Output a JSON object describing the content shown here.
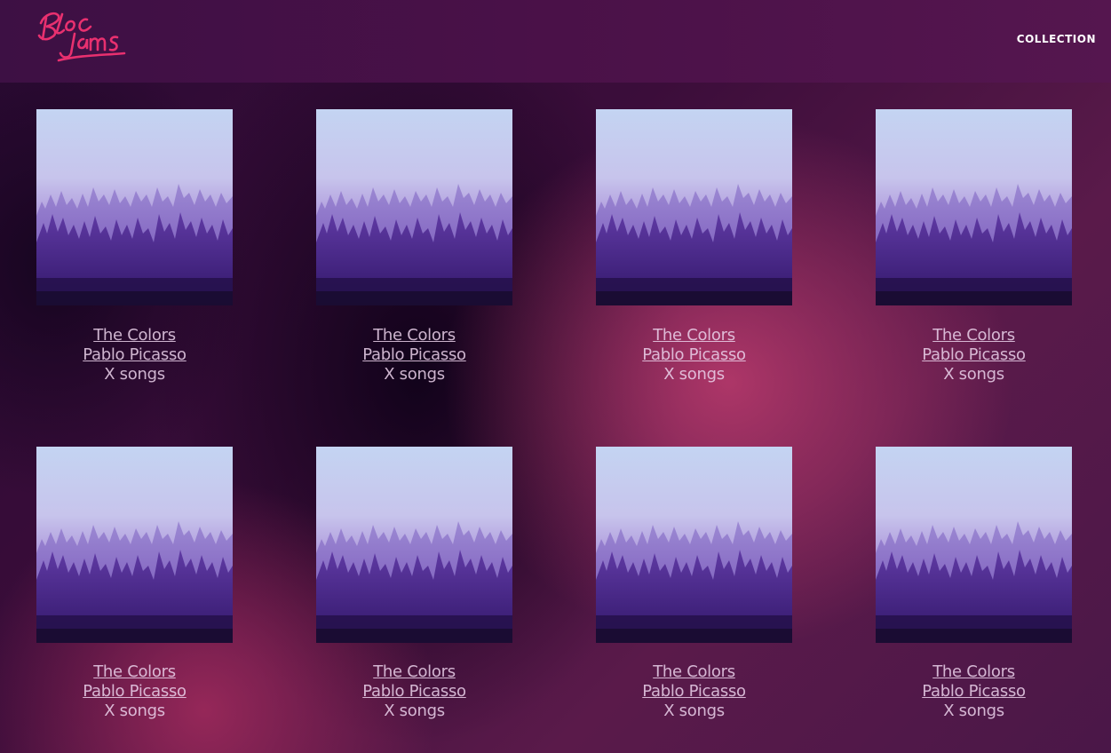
{
  "app": {
    "logo_text": "Bloc Jams",
    "brand_color": "#e8306f"
  },
  "navbar": {
    "collection_label": "COLLECTION"
  },
  "albums": [
    {
      "title": "The Colors ",
      "artist": "Pablo Picasso ",
      "count": "X songs"
    },
    {
      "title": "The Colors ",
      "artist": "Pablo Picasso ",
      "count": "X songs"
    },
    {
      "title": "The Colors ",
      "artist": "Pablo Picasso ",
      "count": "X songs"
    },
    {
      "title": "The Colors ",
      "artist": "Pablo Picasso ",
      "count": "X songs"
    },
    {
      "title": "The Colors ",
      "artist": "Pablo Picasso ",
      "count": "X songs"
    },
    {
      "title": "The Colors ",
      "artist": "Pablo Picasso ",
      "count": "X songs"
    },
    {
      "title": "The Colors ",
      "artist": "Pablo Picasso ",
      "count": "X songs"
    },
    {
      "title": "The Colors ",
      "artist": "Pablo Picasso ",
      "count": "X songs"
    }
  ]
}
